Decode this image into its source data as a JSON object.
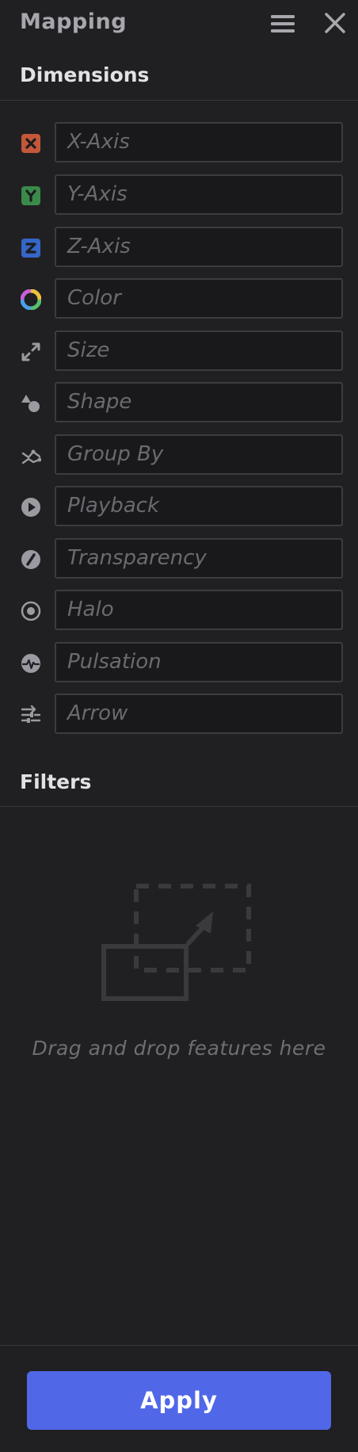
{
  "header": {
    "title": "Mapping",
    "menu_icon": "hamburger-menu-icon",
    "close_icon": "close-icon"
  },
  "dimensions": {
    "title": "Dimensions",
    "items": [
      {
        "key": "x",
        "label": "X-Axis",
        "icon": "x-axis-icon",
        "color": "#c4573a"
      },
      {
        "key": "y",
        "label": "Y-Axis",
        "icon": "y-axis-icon",
        "color": "#3a8a4a"
      },
      {
        "key": "z",
        "label": "Z-Axis",
        "icon": "z-axis-icon",
        "color": "#3566c8"
      },
      {
        "key": "color",
        "label": "Color",
        "icon": "color-wheel-icon"
      },
      {
        "key": "size",
        "label": "Size",
        "icon": "expand-arrows-icon"
      },
      {
        "key": "shape",
        "label": "Shape",
        "icon": "shapes-icon"
      },
      {
        "key": "group",
        "label": "Group By",
        "icon": "group-by-icon"
      },
      {
        "key": "playback",
        "label": "Playback",
        "icon": "play-circle-icon"
      },
      {
        "key": "transparency",
        "label": "Transparency",
        "icon": "transparency-icon"
      },
      {
        "key": "halo",
        "label": "Halo",
        "icon": "halo-icon"
      },
      {
        "key": "pulsation",
        "label": "Pulsation",
        "icon": "pulse-icon"
      },
      {
        "key": "arrow",
        "label": "Arrow",
        "icon": "arrow-sliders-icon"
      }
    ]
  },
  "filters": {
    "title": "Filters",
    "drop_text": "Drag and drop features here",
    "drop_icon": "drag-drop-icon"
  },
  "footer": {
    "apply_label": "Apply",
    "apply_color": "#5068e8"
  },
  "colors": {
    "background": "#202022",
    "field_background": "#19191b",
    "field_border": "#3c3c40",
    "icon_gray": "#9a9aa0"
  }
}
